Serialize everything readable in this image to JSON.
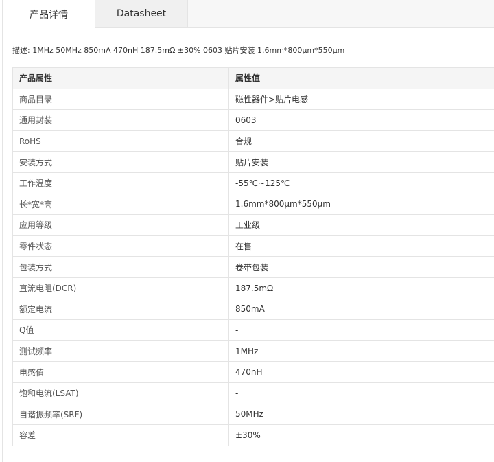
{
  "tabs": [
    {
      "label": "产品详情",
      "active": true
    },
    {
      "label": "Datasheet",
      "active": false
    }
  ],
  "description": {
    "label": "描述:",
    "text": "1MHz 50MHz 850mA 470nH 187.5mΩ ±30% 0603 贴片安装 1.6mm*800μm*550μm"
  },
  "table": {
    "headers": [
      "产品属性",
      "属性值"
    ],
    "rows": [
      [
        "商品目录",
        "磁性器件>贴片电感"
      ],
      [
        "通用封装",
        "0603"
      ],
      [
        "RoHS",
        "合规"
      ],
      [
        "安装方式",
        "贴片安装"
      ],
      [
        "工作温度",
        "-55℃~125℃"
      ],
      [
        "长*宽*高",
        "1.6mm*800μm*550μm"
      ],
      [
        "应用等级",
        "工业级"
      ],
      [
        "零件状态",
        "在售"
      ],
      [
        "包装方式",
        "卷带包装"
      ],
      [
        "直流电阻(DCR)",
        "187.5mΩ"
      ],
      [
        "额定电流",
        "850mA"
      ],
      [
        "Q值",
        "-"
      ],
      [
        "测试频率",
        "1MHz"
      ],
      [
        "电感值",
        "470nH"
      ],
      [
        "饱和电流(LSAT)",
        "-"
      ],
      [
        "自谐振频率(SRF)",
        "50MHz"
      ],
      [
        "容差",
        "±30%"
      ]
    ]
  }
}
